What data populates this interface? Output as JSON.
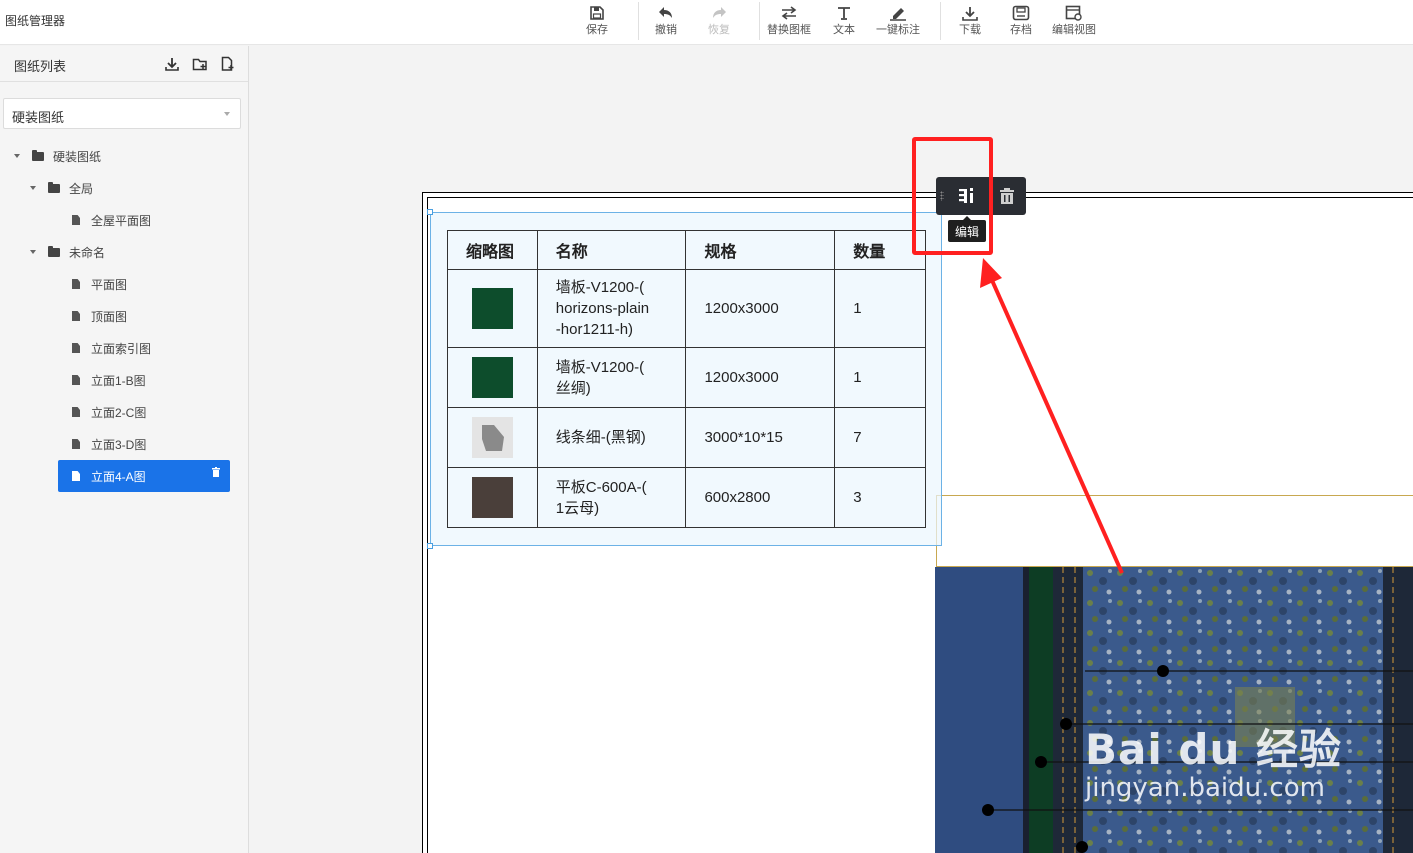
{
  "app": {
    "title": "图纸管理器"
  },
  "toolbar": {
    "save": "保存",
    "undo": "撤销",
    "redo": "恢复",
    "replace_frame": "替换图框",
    "text": "文本",
    "auto_annotate": "一键标注",
    "download": "下载",
    "archive": "存档",
    "edit_view": "编辑视图"
  },
  "sidebar": {
    "title": "图纸列表",
    "select_value": "硬装图纸",
    "tree": [
      {
        "label": "硬装图纸",
        "type": "folder"
      },
      {
        "label": "全局",
        "type": "folder"
      },
      {
        "label": "全屋平面图",
        "type": "file"
      },
      {
        "label": "未命名",
        "type": "folder"
      },
      {
        "label": "平面图",
        "type": "file"
      },
      {
        "label": "顶面图",
        "type": "file"
      },
      {
        "label": "立面索引图",
        "type": "file"
      },
      {
        "label": "立面1-B图",
        "type": "file"
      },
      {
        "label": "立面2-C图",
        "type": "file"
      },
      {
        "label": "立面3-D图",
        "type": "file"
      },
      {
        "label": "立面4-A图",
        "type": "file",
        "selected": true
      }
    ]
  },
  "bom_table": {
    "headers": [
      "缩略图",
      "名称",
      "规格",
      "数量"
    ],
    "rows": [
      {
        "name": "墙板-V1200-(horizons-plain-hor1211-h)",
        "name_lines": [
          "墙板-V1200-(",
          "horizons-plain",
          "-hor1211-h)"
        ],
        "spec": "1200x3000",
        "qty": "1",
        "swatch": "#0d4d2c"
      },
      {
        "name": "墙板-V1200-(丝绸)",
        "name_lines": [
          "墙板-V1200-(",
          "丝绸)"
        ],
        "spec": "1200x3000",
        "qty": "1",
        "swatch": "#0d4d2c"
      },
      {
        "name": "线条细-(黑钢)",
        "name_lines": [
          "线条细-(黑钢)"
        ],
        "spec": "3000*10*15",
        "qty": "7",
        "swatch": "#8a8a8a"
      },
      {
        "name": "平板C-600A-(1云母)",
        "name_lines": [
          "平板C-600A-(",
          "1云母)"
        ],
        "spec": "600x2800",
        "qty": "3",
        "swatch": "#4a3f3a"
      }
    ]
  },
  "float_toolbar": {
    "tooltip": "编辑"
  },
  "watermark": {
    "main": "Bai du 经验",
    "sub": "jingyan.baidu.com"
  },
  "colors": {
    "accent": "#1a73e8",
    "highlight": "#ff2020",
    "selection": "#6cb2e6"
  }
}
